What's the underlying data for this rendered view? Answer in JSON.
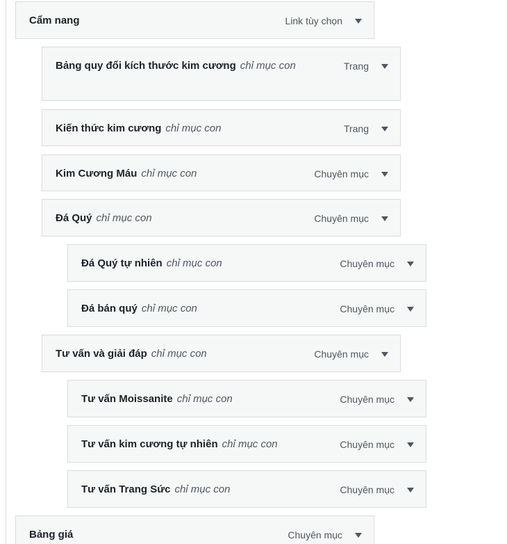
{
  "menu": {
    "items": [
      {
        "name": "Cẩm nang",
        "sub": "",
        "type": "Link tùy chọn"
      },
      {
        "name": "Bảng quy đổi kích thước kim cương",
        "sub": "chỉ mục con",
        "type": "Trang"
      },
      {
        "name": "Kiến thức kim cương",
        "sub": "chỉ mục con",
        "type": "Trang"
      },
      {
        "name": "Kim Cương Máu",
        "sub": "chỉ mục con",
        "type": "Chuyên mục"
      },
      {
        "name": "Đá Quý",
        "sub": "chỉ mục con",
        "type": "Chuyên mục"
      },
      {
        "name": "Đá Quý tự nhiên",
        "sub": "chỉ mục con",
        "type": "Chuyên mục"
      },
      {
        "name": "Đá bán quý",
        "sub": "chỉ mục con",
        "type": "Chuyên mục"
      },
      {
        "name": "Tư vấn và giải đáp",
        "sub": "chỉ mục con",
        "type": "Chuyên mục"
      },
      {
        "name": "Tư vấn Moissanite",
        "sub": "chỉ mục con",
        "type": "Chuyên mục"
      },
      {
        "name": "Tư vấn kim cương tự nhiên",
        "sub": "chỉ mục con",
        "type": "Chuyên mục"
      },
      {
        "name": "Tư vấn Trang Sức",
        "sub": "chỉ mục con",
        "type": "Chuyên mục"
      },
      {
        "name": "Bảng giá",
        "sub": "",
        "type": "Chuyên mục"
      }
    ],
    "toggle_icon": "caret-down-icon"
  }
}
